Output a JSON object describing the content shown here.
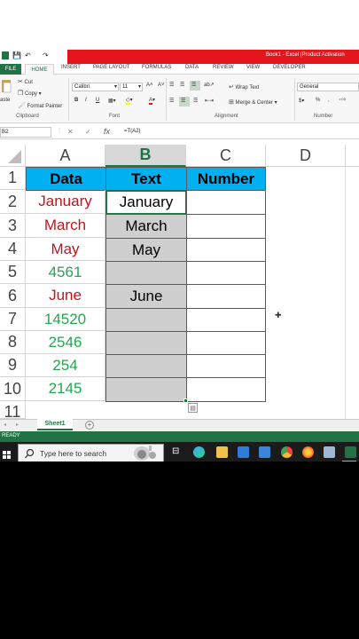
{
  "window": {
    "title": "Book1 - Excel (Product Activation"
  },
  "ribbon": {
    "tabs": [
      "FILE",
      "HOME",
      "INSERT",
      "PAGE LAYOUT",
      "FORMULAS",
      "DATA",
      "REVIEW",
      "VIEW",
      "DEVELOPER"
    ],
    "clipboard": {
      "cut": "Cut",
      "copy": "Copy",
      "paste": "aste",
      "format_painter": "Format Painter",
      "group": "Clipboard"
    },
    "font": {
      "name": "Calibri",
      "size": "11",
      "bold": "B",
      "italic": "I",
      "underline": "U",
      "group": "Font"
    },
    "alignment": {
      "wrap": "Wrap Text",
      "merge": "Merge & Center",
      "group": "Alignment"
    },
    "number": {
      "format": "General",
      "percent": "%",
      "comma": ",",
      "group": "Number"
    }
  },
  "formula_bar": {
    "name_box": "B2",
    "fx": "fx",
    "formula": "=T(A2)"
  },
  "grid": {
    "columns": [
      "A",
      "B",
      "C",
      "D"
    ],
    "rows": [
      "1",
      "2",
      "3",
      "4",
      "5",
      "6",
      "7",
      "8",
      "9",
      "10",
      "11"
    ],
    "headers": [
      "Data",
      "Text",
      "Number"
    ],
    "data_col": [
      "January",
      "March",
      "May",
      "4561",
      "June",
      "14520",
      "2546",
      "254",
      "2145"
    ],
    "text_col": [
      "January",
      "March",
      "May",
      "",
      "June",
      "",
      "",
      "",
      ""
    ]
  },
  "sheets": {
    "active": "Sheet1"
  },
  "status": {
    "text": "READY"
  },
  "taskbar": {
    "search_placeholder": "Type here to search"
  },
  "colors": {
    "excel_green": "#217346",
    "title_red": "#e4151b",
    "header_cyan": "#00b0f0",
    "text_red": "#c0141c",
    "number_green": "#24a552"
  }
}
